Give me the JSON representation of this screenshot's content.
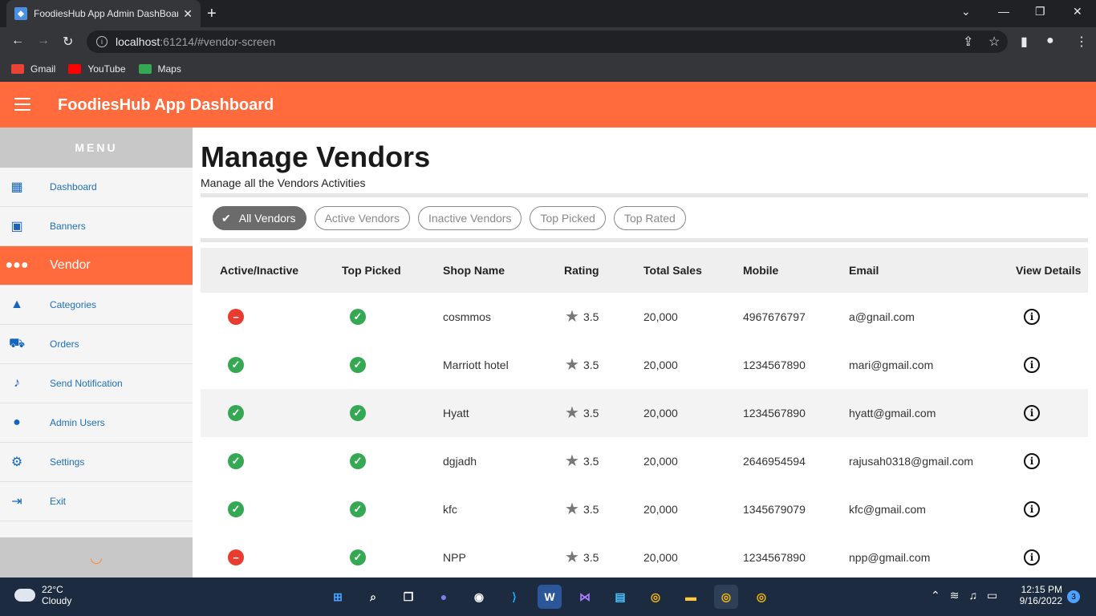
{
  "browser": {
    "tab_title": "FoodiesHub App Admin DashBoard",
    "url_host": "localhost",
    "url_path": ":61214/#vendor-screen",
    "bookmarks": [
      {
        "label": "Gmail",
        "icon": "gmail-icon",
        "color": "#ea4335"
      },
      {
        "label": "YouTube",
        "icon": "youtube-icon",
        "color": "#ff0000"
      },
      {
        "label": "Maps",
        "icon": "maps-icon",
        "color": "#34a853"
      }
    ]
  },
  "header": {
    "title": "FoodiesHub App Dashboard",
    "color": "#ff6b3d"
  },
  "sidebar": {
    "menu_label": "MENU",
    "items": [
      {
        "label": "Dashboard",
        "icon": "dashboard-icon"
      },
      {
        "label": "Banners",
        "icon": "image-icon"
      },
      {
        "label": "Vendor",
        "icon": "people-icon",
        "active": true
      },
      {
        "label": "Categories",
        "icon": "categories-icon"
      },
      {
        "label": "Orders",
        "icon": "cart-icon"
      },
      {
        "label": "Send Notification",
        "icon": "bell-icon"
      },
      {
        "label": "Admin Users",
        "icon": "person-icon"
      },
      {
        "label": "Settings",
        "icon": "gear-icon"
      },
      {
        "label": "Exit",
        "icon": "exit-icon"
      }
    ]
  },
  "main": {
    "title": "Manage Vendors",
    "subtitle": "Manage all the Vendors Activities",
    "filters": [
      {
        "label": "All Vendors",
        "selected": true
      },
      {
        "label": "Active Vendors",
        "selected": false
      },
      {
        "label": "Inactive Vendors",
        "selected": false
      },
      {
        "label": "Top Picked",
        "selected": false
      },
      {
        "label": "Top Rated",
        "selected": false
      }
    ],
    "columns": [
      "Active/Inactive",
      "Top Picked",
      "Shop Name",
      "Rating",
      "Total Sales",
      "Mobile",
      "Email",
      "View Details"
    ],
    "rows": [
      {
        "active": false,
        "top_picked": true,
        "shop": "cosmmos",
        "rating": "3.5",
        "sales": "20,000",
        "mobile": "4967676797",
        "email": "a@gnail.com"
      },
      {
        "active": true,
        "top_picked": true,
        "shop": "Marriott hotel",
        "rating": "3.5",
        "sales": "20,000",
        "mobile": "1234567890",
        "email": "mari@gmail.com"
      },
      {
        "active": true,
        "top_picked": true,
        "shop": "Hyatt",
        "rating": "3.5",
        "sales": "20,000",
        "mobile": "1234567890",
        "email": "hyatt@gmail.com"
      },
      {
        "active": true,
        "top_picked": true,
        "shop": "dgjadh",
        "rating": "3.5",
        "sales": "20,000",
        "mobile": "2646954594",
        "email": "rajusah0318@gmail.com"
      },
      {
        "active": true,
        "top_picked": true,
        "shop": "kfc",
        "rating": "3.5",
        "sales": "20,000",
        "mobile": "1345679079",
        "email": "kfc@gmail.com"
      },
      {
        "active": false,
        "top_picked": true,
        "shop": "NPP",
        "rating": "3.5",
        "sales": "20,000",
        "mobile": "1234567890",
        "email": "npp@gmail.com"
      }
    ]
  },
  "taskbar": {
    "temp": "22°C",
    "weather": "Cloudy",
    "time": "12:15 PM",
    "date": "9/16/2022",
    "notifications": "3"
  }
}
